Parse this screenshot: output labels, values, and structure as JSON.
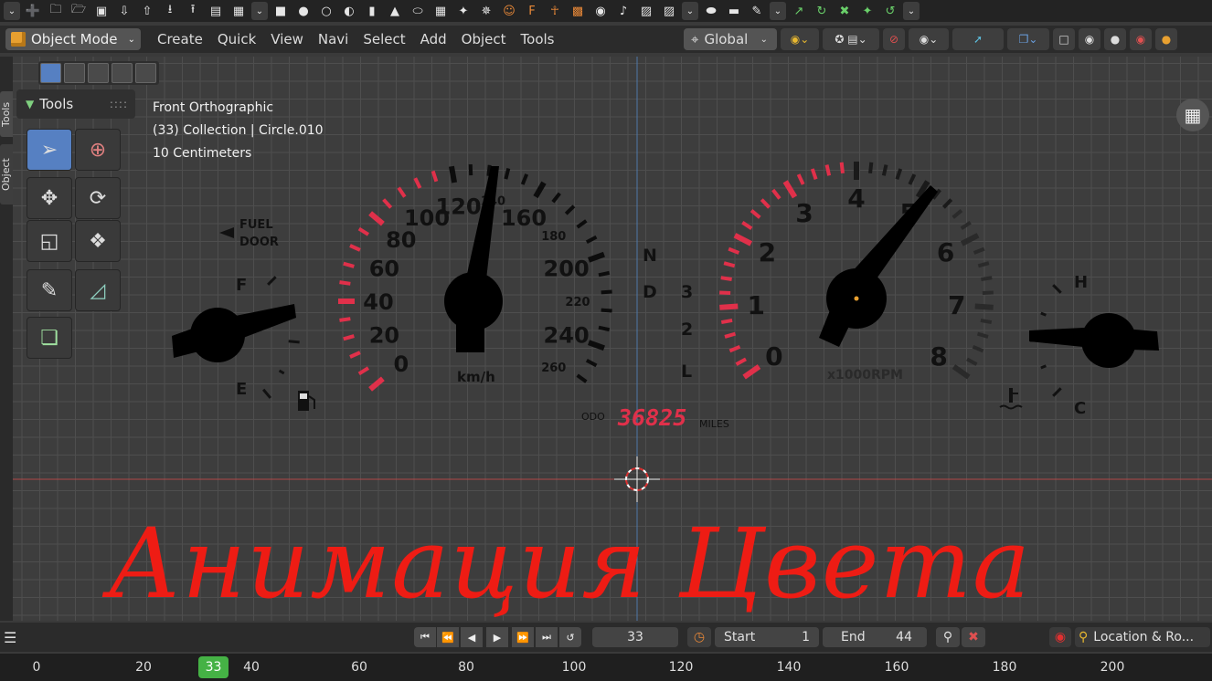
{
  "toolbar": {
    "icons": [
      "dropdown-icon",
      "new-file-icon",
      "new-folder-icon",
      "open-file-icon",
      "save-icon",
      "import-icon",
      "export-icon",
      "download-icon",
      "upload-icon",
      "render-icon",
      "clapper-icon",
      "dropdown-icon",
      "cube-icon",
      "sphere-icon",
      "circle-icon",
      "uv-sphere-icon",
      "cylinder-icon",
      "cone-icon",
      "torus-icon",
      "grid-icon",
      "vertex-icon",
      "node-icon",
      "monkey-icon",
      "text-icon",
      "armature-icon",
      "lattice-icon",
      "camera-icon",
      "speaker-icon",
      "image-icon",
      "image-icon",
      "dropdown-icon",
      "metaball-icon",
      "surface-icon",
      "brush-icon",
      "dropdown-icon",
      "link-icon",
      "refresh-icon",
      "shrink-icon",
      "expand-icon",
      "reload-icon",
      "dropdown-icon"
    ]
  },
  "header": {
    "mode": "Object Mode",
    "menu": [
      "Create",
      "Quick",
      "View",
      "Navi",
      "Select",
      "Add",
      "Object",
      "Tools"
    ],
    "orientation": "Global"
  },
  "sidebar_tabs": [
    "Tools",
    "Object"
  ],
  "tools_panel": {
    "title": "Tools",
    "tools": [
      "select-box",
      "cursor",
      "move",
      "rotate",
      "scale",
      "transform",
      "annotate",
      "measure",
      "add-cube"
    ]
  },
  "viewport": {
    "view_name": "Front Orthographic",
    "collection": "(33) Collection | Circle.010",
    "scale": "10 Centimeters"
  },
  "dashboard": {
    "fuel_label_1": "FUEL",
    "fuel_label_2": "DOOR",
    "fuel_full": "F",
    "fuel_empty": "E",
    "speed_labels": [
      "0",
      "20",
      "40",
      "60",
      "80",
      "100",
      "120",
      "140",
      "160",
      "180",
      "200",
      "220",
      "240",
      "260"
    ],
    "speed_unit": "km/h",
    "gears": [
      "N",
      "D",
      "3",
      "2",
      "L"
    ],
    "odo_label": "ODO",
    "odo_value": "36825",
    "odo_unit": "MILES",
    "rpm_labels": [
      "0",
      "1",
      "2",
      "3",
      "4",
      "5",
      "6",
      "7",
      "8"
    ],
    "rpm_unit": "x1000RPM",
    "temp_hot": "H",
    "temp_cold": "C"
  },
  "overlay_title": "Анимация Цвета",
  "timeline": {
    "current_frame": "33",
    "start_label": "Start",
    "start_value": "1",
    "end_label": "End",
    "end_value": "44",
    "keying": "Location & Ro...",
    "ruler": [
      "0",
      "20",
      "40",
      "60",
      "80",
      "100",
      "120",
      "140",
      "160",
      "180",
      "200"
    ],
    "ruler_current": "33"
  },
  "colors": {
    "accent_blue": "#5680c2",
    "header_bg": "#2b2b2b",
    "red_zone": "#e0304a",
    "title_red": "#ee1c14",
    "frame_green": "#45b245"
  }
}
